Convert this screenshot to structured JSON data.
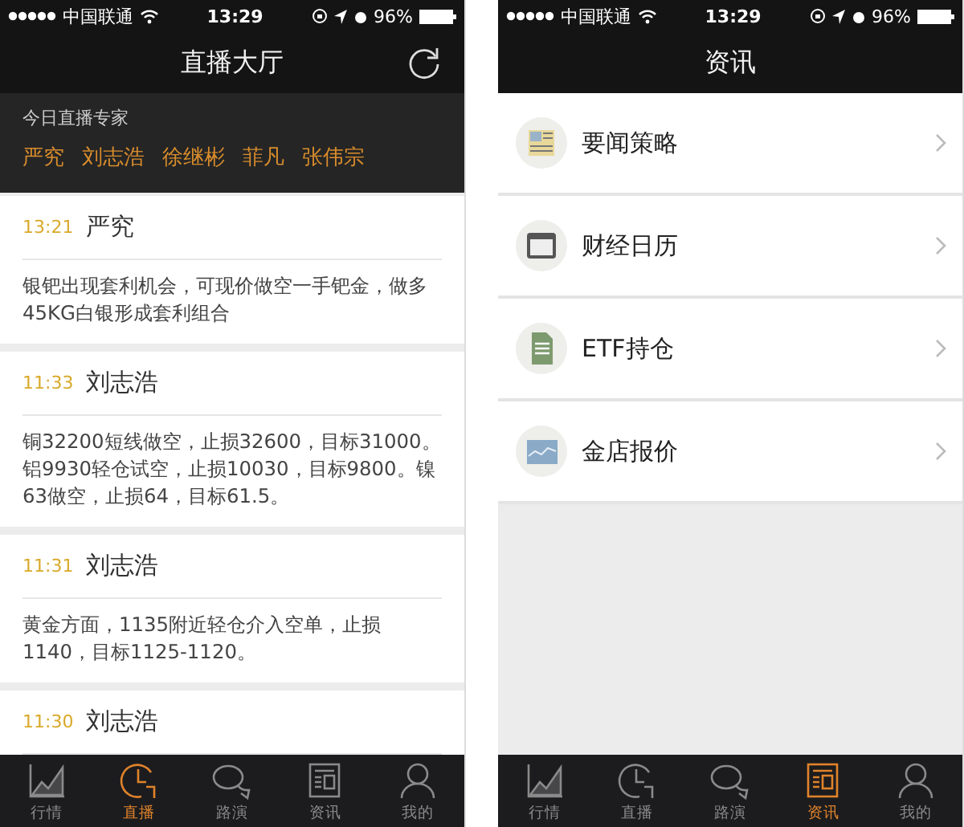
{
  "screens": [
    {
      "kind": "live",
      "status_bar": {
        "carrier": "中国联通",
        "time": "13:29",
        "battery": "96%"
      },
      "title": "直播大厅",
      "experts": {
        "label": "今日直播专家",
        "names": [
          "严究",
          "刘志浩",
          "徐继彬",
          "菲凡",
          "张伟宗"
        ]
      },
      "posts": [
        {
          "time": "13:21",
          "author": "严究",
          "text": "银钯出现套利机会，可现价做空一手钯金，做多45KG白银形成套利组合"
        },
        {
          "time": "11:33",
          "author": "刘志浩",
          "text": "铜32200短线做空，止损32600，目标31000。铝9930轻仓试空，止损10030，目标9800。镍63做空，止损64，目标61.5。"
        },
        {
          "time": "11:31",
          "author": "刘志浩",
          "text": "黄金方面，1135附近轻仓介入空单，止损1140，目标1125-1120。"
        },
        {
          "time": "11:30",
          "author": "刘志浩"
        }
      ],
      "tabs": [
        {
          "label": "行情",
          "selected": false
        },
        {
          "label": "直播",
          "selected": true
        },
        {
          "label": "路演",
          "selected": false
        },
        {
          "label": "资讯",
          "selected": false
        },
        {
          "label": "我的",
          "selected": false
        }
      ]
    },
    {
      "kind": "news",
      "status_bar": {
        "carrier": "中国联通",
        "time": "13:29",
        "battery": "96%"
      },
      "title": "资讯",
      "items": [
        {
          "label": "要闻策略"
        },
        {
          "label": "财经日历"
        },
        {
          "label": "ETF持仓"
        },
        {
          "label": "金店报价"
        }
      ],
      "tabs": [
        {
          "label": "行情",
          "selected": false
        },
        {
          "label": "直播",
          "selected": false
        },
        {
          "label": "路演",
          "selected": false
        },
        {
          "label": "资讯",
          "selected": true
        },
        {
          "label": "我的",
          "selected": false
        }
      ]
    }
  ]
}
